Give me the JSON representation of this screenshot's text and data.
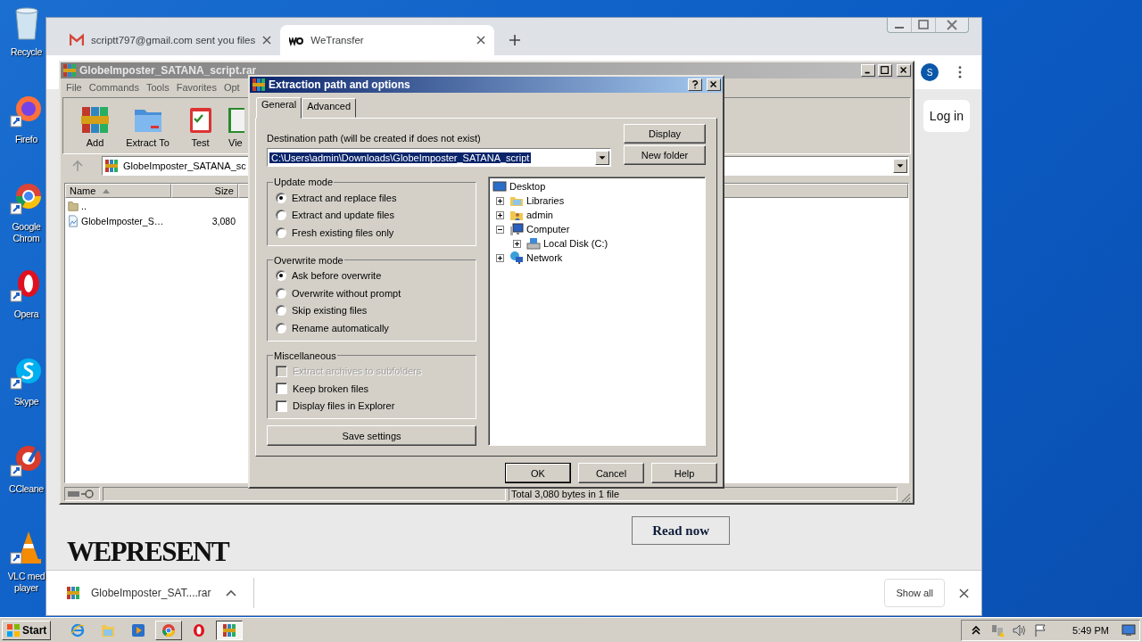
{
  "desktop_icons": [
    {
      "label": "Recycle",
      "kind": "recycle"
    },
    {
      "label": "Firefo",
      "kind": "firefox"
    },
    {
      "label": "Google Chrom",
      "kind": "chrome"
    },
    {
      "label": "Opera",
      "kind": "opera"
    },
    {
      "label": "Skype",
      "kind": "skype"
    },
    {
      "label": "CCleane",
      "kind": "ccleaner"
    },
    {
      "label": "VLC med player",
      "kind": "vlc"
    }
  ],
  "browser": {
    "tabs": [
      {
        "title": "scriptt797@gmail.com sent you files",
        "kind": "mail",
        "selected": false
      },
      {
        "title": "WeTransfer",
        "kind": "we",
        "selected": true
      }
    ],
    "avatar": "S",
    "login": "Log in",
    "brand": "WEPRESENT",
    "read_now": "Read now",
    "download": {
      "file": "GlobeImposter_SAT....rar",
      "show_all": "Show all"
    }
  },
  "winrar": {
    "title": "GlobeImposter_SATANA_script.rar",
    "menu": [
      "File",
      "Commands",
      "Tools",
      "Favorites",
      "Opt"
    ],
    "toolbar": [
      {
        "label": "Add",
        "kind": "add"
      },
      {
        "label": "Extract To",
        "kind": "extract"
      },
      {
        "label": "Test",
        "kind": "test"
      },
      {
        "label": "Vie",
        "kind": "view"
      }
    ],
    "path": "GlobeImposter_SATANA_sc",
    "columns": [
      "Name",
      "Size"
    ],
    "rows": [
      {
        "kind": "parent",
        "name": ".."
      },
      {
        "kind": "file",
        "name": "GlobeImposter_S…",
        "size": "3,080"
      }
    ],
    "status": "Total 3,080 bytes in 1 file"
  },
  "dialog": {
    "title": "Extraction path and options",
    "tabs": [
      {
        "label": "General",
        "selected": true
      },
      {
        "label": "Advanced",
        "selected": false
      }
    ],
    "destination_label": "Destination path (will be created if does not exist)",
    "destination": "C:\\Users\\admin\\Downloads\\GlobeImposter_SATANA_script",
    "side_buttons": [
      "Display",
      "New folder"
    ],
    "groups": [
      {
        "title": "Update mode",
        "kind": "radio",
        "options": [
          {
            "label": "Extract and replace files",
            "selected": true
          },
          {
            "label": "Extract and update files",
            "selected": false
          },
          {
            "label": "Fresh existing files only",
            "selected": false
          }
        ]
      },
      {
        "title": "Overwrite mode",
        "kind": "radio",
        "options": [
          {
            "label": "Ask before overwrite",
            "selected": true
          },
          {
            "label": "Overwrite without prompt",
            "selected": false
          },
          {
            "label": "Skip existing files",
            "selected": false
          },
          {
            "label": "Rename automatically",
            "selected": false
          }
        ]
      },
      {
        "title": "Miscellaneous",
        "kind": "checkbox",
        "options": [
          {
            "label": "Extract archives to subfolders",
            "checked": false,
            "disabled": true
          },
          {
            "label": "Keep broken files",
            "checked": false,
            "disabled": false
          },
          {
            "label": "Display files in Explorer",
            "checked": false,
            "disabled": false
          }
        ]
      }
    ],
    "save": "Save settings",
    "tree": [
      {
        "label": "Desktop",
        "kind": "desktop",
        "children": [
          {
            "label": "Libraries",
            "kind": "libraries",
            "expanded": false
          },
          {
            "label": "admin",
            "kind": "user",
            "expanded": false
          },
          {
            "label": "Computer",
            "kind": "computer",
            "expanded": true,
            "children": [
              {
                "label": "Local Disk (C:)",
                "kind": "disk",
                "expanded": false
              }
            ]
          },
          {
            "label": "Network",
            "kind": "network",
            "expanded": false
          }
        ]
      }
    ],
    "buttons": [
      {
        "label": "OK",
        "default": true
      },
      {
        "label": "Cancel",
        "default": false
      },
      {
        "label": "Help",
        "default": false
      }
    ]
  },
  "taskbar": {
    "start": "Start",
    "apps": [
      {
        "kind": "ie",
        "open": false,
        "active": false
      },
      {
        "kind": "explorer",
        "open": false,
        "active": false
      },
      {
        "kind": "media",
        "open": false,
        "active": false
      },
      {
        "kind": "chrome",
        "open": true,
        "active": false
      },
      {
        "kind": "opera",
        "open": false,
        "active": false
      },
      {
        "kind": "winrar",
        "open": true,
        "active": true
      }
    ],
    "clock": "5:49 PM"
  }
}
